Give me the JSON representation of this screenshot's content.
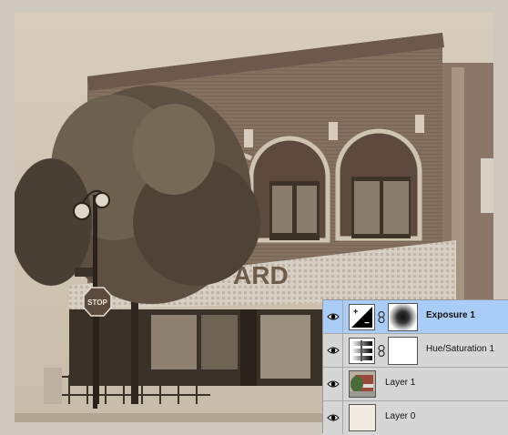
{
  "layers_panel": {
    "layers": [
      {
        "name": "Exposure 1",
        "type": "adjustment",
        "icon": "exposure-icon",
        "selected": true
      },
      {
        "name": "Hue/Saturation 1",
        "type": "adjustment",
        "icon": "hue-saturation-icon",
        "selected": false
      },
      {
        "name": "Layer 1",
        "type": "pixel",
        "icon": "photo-thumbnail",
        "selected": false
      },
      {
        "name": "Layer 0",
        "type": "pixel",
        "icon": "blank-thumbnail",
        "selected": false
      }
    ]
  },
  "store_sign": "ARD",
  "stop_sign": "STOP",
  "colors": {
    "selection": "#a9cdf6",
    "panel": "#d6d6d6",
    "sepia_light": "#cfc3b1",
    "sepia_dark": "#3a3128"
  }
}
